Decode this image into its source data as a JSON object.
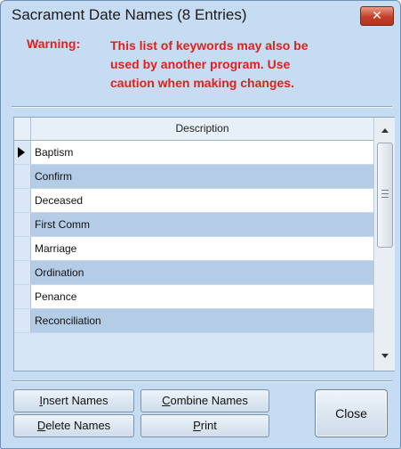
{
  "window": {
    "title": "Sacrament Date Names (8 Entries)",
    "close_glyph": "✕"
  },
  "warning": {
    "label": "Warning:",
    "lines": [
      "This list of keywords may also be",
      "used by another program. Use",
      "caution when making changes."
    ],
    "color": "#e0201a"
  },
  "grid": {
    "column_header": "Description",
    "rows": [
      "Baptism",
      "Confirm",
      "Deceased",
      "First Comm",
      "Marriage",
      "Ordination",
      "Penance",
      "Reconciliation"
    ],
    "current_row_index": 0,
    "scroll_grip_glyph": "≡"
  },
  "buttons": {
    "insert": {
      "mnemonic": "I",
      "rest": "nsert Names"
    },
    "combine": {
      "mnemonic": "C",
      "rest": "ombine Names"
    },
    "delete": {
      "mnemonic": "D",
      "rest": "elete Names"
    },
    "print": {
      "mnemonic": "P",
      "rest": "rint"
    },
    "close": "Close"
  }
}
